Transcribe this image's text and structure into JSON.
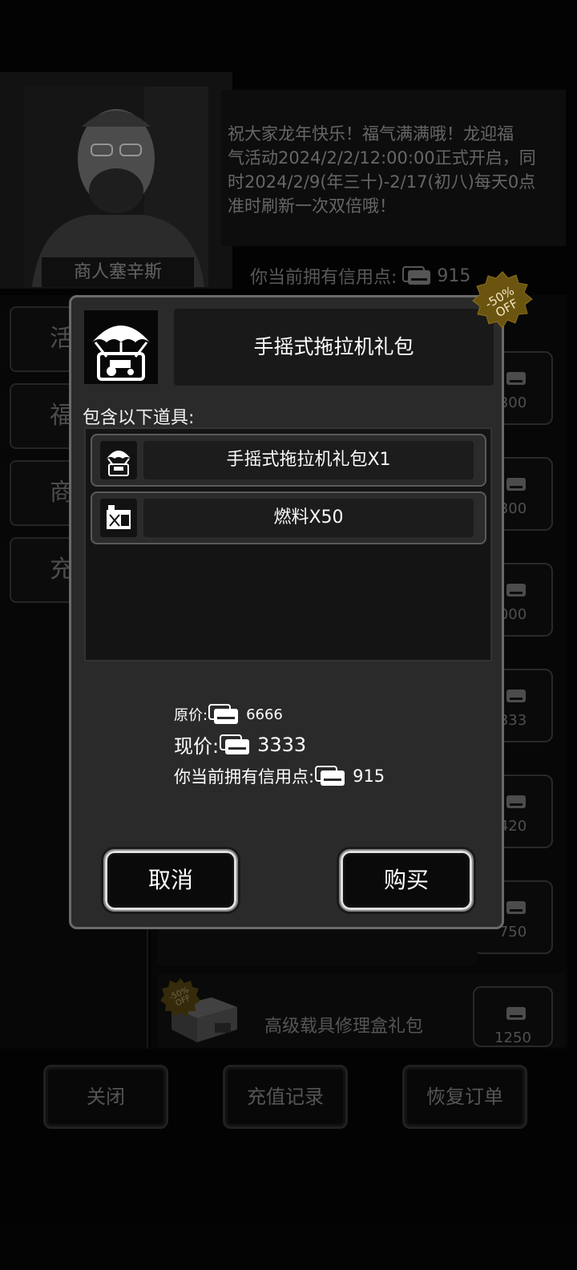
{
  "merchant": {
    "name": "商人塞辛斯",
    "announcement_lines": [
      "祝大家龙年快乐！福气满满哦！龙迎福",
      "气活动2024/2/2/12:00:00正式开启，同",
      "时2024/2/9(年三十)-2/17(初八)每天0点",
      "准时刷新一次双倍哦！"
    ]
  },
  "header_credit": {
    "label": "你当前拥有信用点:",
    "value": "915"
  },
  "categories": [
    "活",
    "福",
    "商",
    "充"
  ],
  "shop_prices": [
    "300",
    "300",
    "000",
    "333",
    "420",
    "750",
    "1250"
  ],
  "shop_row_title": "高级载具修理盒礼包",
  "shop_row_badge": {
    "pct": "-50%",
    "off": "OFF"
  },
  "bottom_buttons": {
    "close": "关闭",
    "recharge_record": "充值记录",
    "restore_order": "恢复订单"
  },
  "dialog": {
    "title": "手摇式拖拉机礼包",
    "badge": {
      "pct": "-50%",
      "off": "OFF"
    },
    "contains_label": "包含以下道具:",
    "items": [
      {
        "label": "手摇式拖拉机礼包X1",
        "icon": "parachute-tractor-icon"
      },
      {
        "label": "燃料X50",
        "icon": "fuel-can-icon"
      }
    ],
    "original_price": {
      "label": "原价:",
      "value": "6666"
    },
    "current_price": {
      "label": "现价:",
      "value": "3333"
    },
    "owned_credit": {
      "label": "你当前拥有信用点:",
      "value": "915"
    },
    "cancel_label": "取消",
    "buy_label": "购买"
  },
  "colors": {
    "badge_gold": "#6b5410",
    "dialog_bg": "#2a2a2a",
    "dialog_border": "#6a6a6a"
  }
}
